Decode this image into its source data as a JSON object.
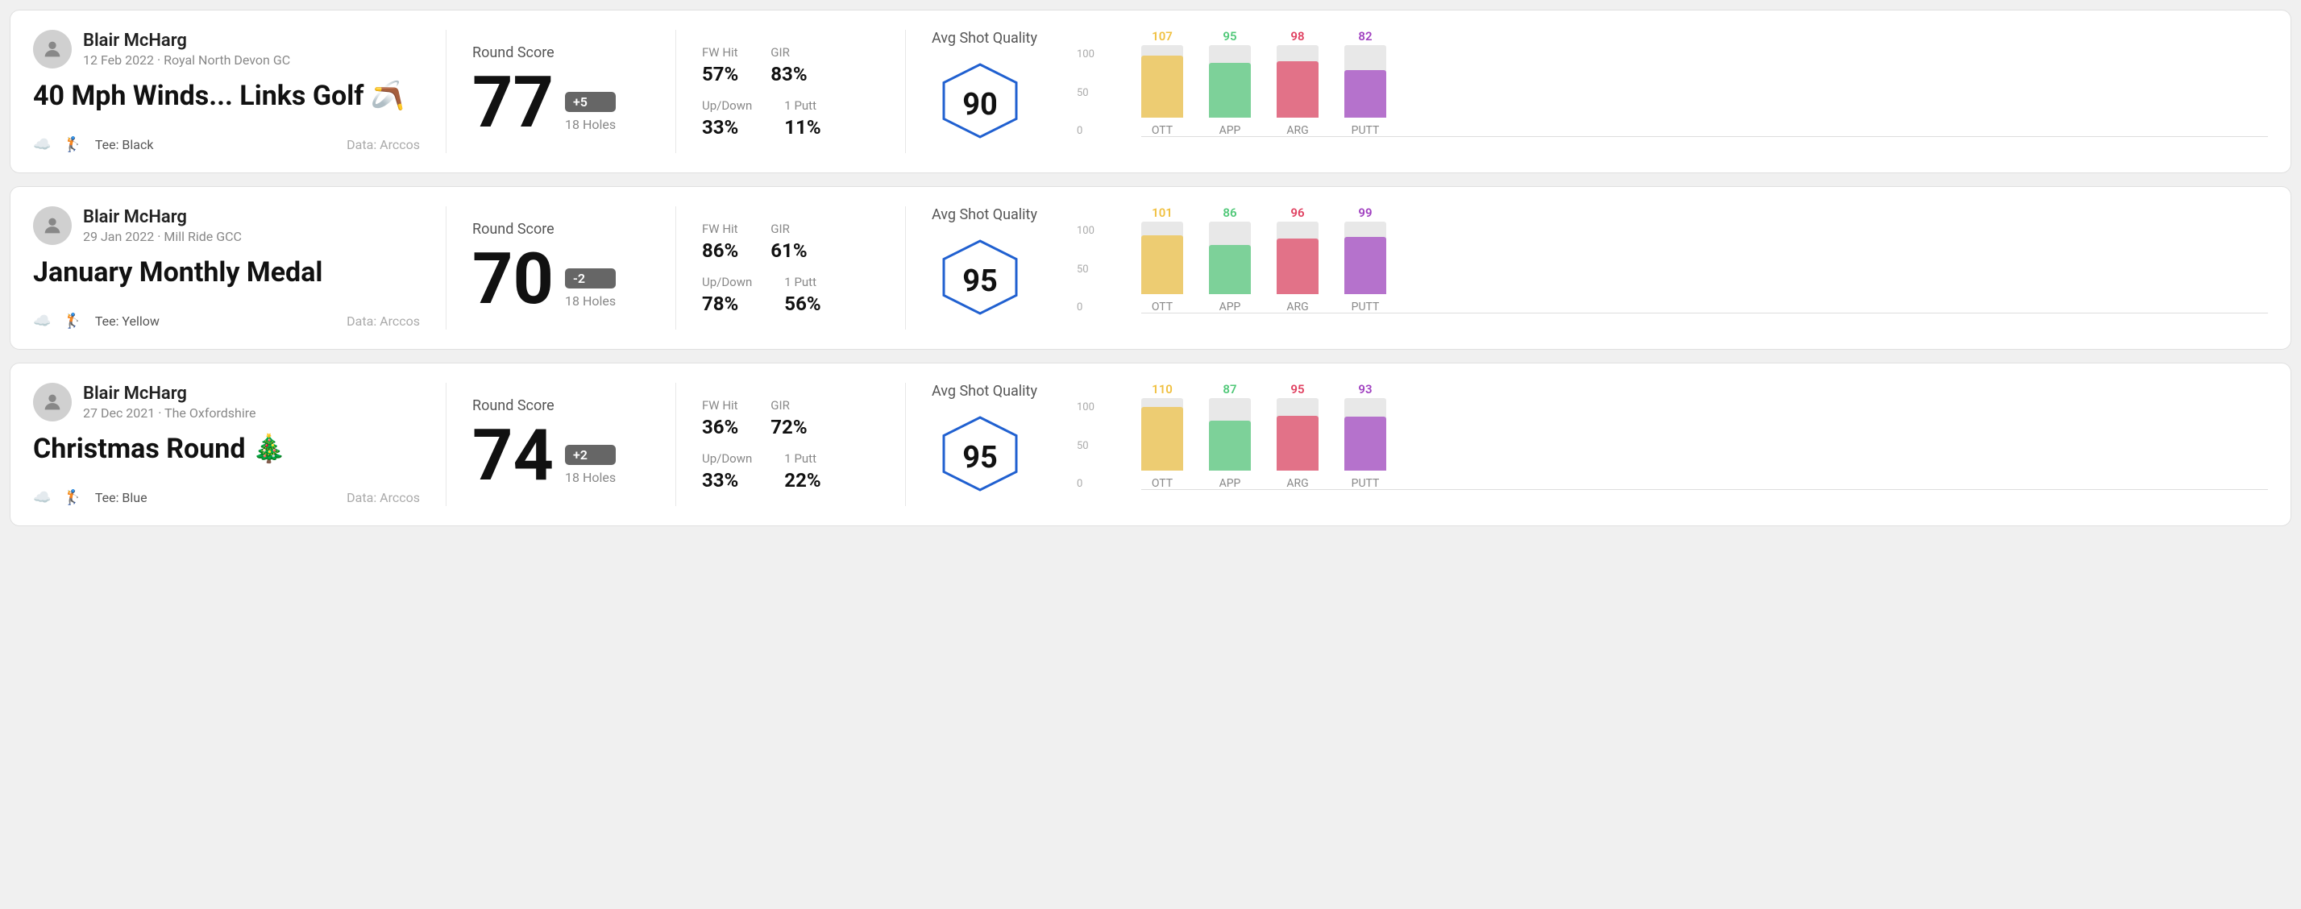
{
  "rounds": [
    {
      "id": "round1",
      "userName": "Blair McHarg",
      "userDate": "12 Feb 2022 · Royal North Devon GC",
      "roundTitle": "40 Mph Winds... Links Golf 🪃",
      "tee": "Black",
      "dataSource": "Data: Arccos",
      "score": "77",
      "scoreBadge": "+5",
      "scoreBadgeType": "positive",
      "holes": "18 Holes",
      "fwHit": "57%",
      "gir": "83%",
      "upDown": "33%",
      "onePutt": "11%",
      "avgShotQuality": "90",
      "chart": {
        "bars": [
          {
            "label": "OTT",
            "value": 107,
            "color": "#f0c040",
            "heightPct": 85
          },
          {
            "label": "APP",
            "value": 95,
            "color": "#50c878",
            "heightPct": 75
          },
          {
            "label": "ARG",
            "value": 98,
            "color": "#e04060",
            "heightPct": 78
          },
          {
            "label": "PUTT",
            "value": 82,
            "color": "#a040c0",
            "heightPct": 65
          }
        ]
      }
    },
    {
      "id": "round2",
      "userName": "Blair McHarg",
      "userDate": "29 Jan 2022 · Mill Ride GCC",
      "roundTitle": "January Monthly Medal",
      "tee": "Yellow",
      "dataSource": "Data: Arccos",
      "score": "70",
      "scoreBadge": "-2",
      "scoreBadgeType": "negative",
      "holes": "18 Holes",
      "fwHit": "86%",
      "gir": "61%",
      "upDown": "78%",
      "onePutt": "56%",
      "avgShotQuality": "95",
      "chart": {
        "bars": [
          {
            "label": "OTT",
            "value": 101,
            "color": "#f0c040",
            "heightPct": 81
          },
          {
            "label": "APP",
            "value": 86,
            "color": "#50c878",
            "heightPct": 68
          },
          {
            "label": "ARG",
            "value": 96,
            "color": "#e04060",
            "heightPct": 77
          },
          {
            "label": "PUTT",
            "value": 99,
            "color": "#a040c0",
            "heightPct": 79
          }
        ]
      }
    },
    {
      "id": "round3",
      "userName": "Blair McHarg",
      "userDate": "27 Dec 2021 · The Oxfordshire",
      "roundTitle": "Christmas Round 🎄",
      "tee": "Blue",
      "dataSource": "Data: Arccos",
      "score": "74",
      "scoreBadge": "+2",
      "scoreBadgeType": "positive",
      "holes": "18 Holes",
      "fwHit": "36%",
      "gir": "72%",
      "upDown": "33%",
      "onePutt": "22%",
      "avgShotQuality": "95",
      "chart": {
        "bars": [
          {
            "label": "OTT",
            "value": 110,
            "color": "#f0c040",
            "heightPct": 88
          },
          {
            "label": "APP",
            "value": 87,
            "color": "#50c878",
            "heightPct": 69
          },
          {
            "label": "ARG",
            "value": 95,
            "color": "#e04060",
            "heightPct": 76
          },
          {
            "label": "PUTT",
            "value": 93,
            "color": "#a040c0",
            "heightPct": 74
          }
        ]
      }
    }
  ],
  "labels": {
    "roundScore": "Round Score",
    "fwHit": "FW Hit",
    "gir": "GIR",
    "upDown": "Up/Down",
    "onePutt": "1 Putt",
    "avgShotQuality": "Avg Shot Quality",
    "teePrefix": "Tee:",
    "scoreLabel": "Round Score"
  }
}
